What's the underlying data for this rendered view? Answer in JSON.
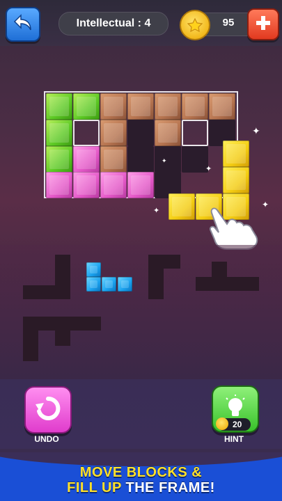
{
  "header": {
    "level_label": "Intellectual : 4",
    "coins": "95"
  },
  "icons": {
    "back": "back-arrow-icon",
    "add": "plus-icon",
    "coin": "coin-icon",
    "undo": "undo-icon",
    "hint": "lightbulb-icon",
    "hand": "pointing-hand-icon"
  },
  "controls": {
    "undo_label": "UNDO",
    "hint_label": "HINT",
    "hint_cost": "20"
  },
  "banner": {
    "line1": "MOVE BLOCKS &",
    "line2_highlight": "FILL UP",
    "line2_rest": " THE FRAME!"
  },
  "colors": {
    "green": "#5cc924",
    "brown": "#b67450",
    "pink": "#e458c8",
    "yellow": "#f4cd12",
    "blue": "#1aa2ee",
    "banner": "#1a4fd6"
  }
}
